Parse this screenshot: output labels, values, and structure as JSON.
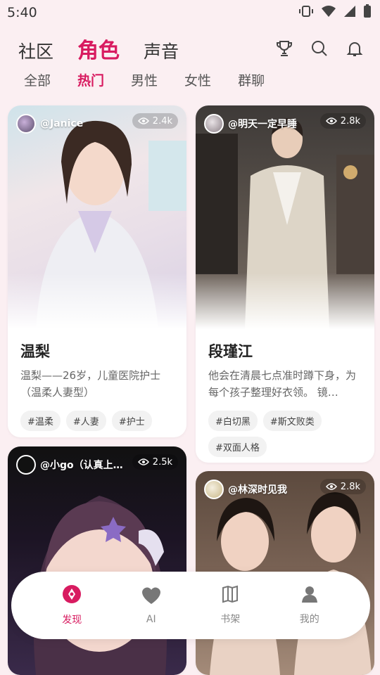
{
  "status_bar": {
    "time": "5:40"
  },
  "top_tabs": [
    {
      "label": "社区",
      "active": false
    },
    {
      "label": "角色",
      "active": true
    },
    {
      "label": "声音",
      "active": false
    }
  ],
  "sub_tabs": [
    {
      "label": "全部",
      "active": false
    },
    {
      "label": "热门",
      "active": true
    },
    {
      "label": "男性",
      "active": false
    },
    {
      "label": "女性",
      "active": false
    },
    {
      "label": "群聊",
      "active": false
    }
  ],
  "cards": [
    {
      "author": "@Janice",
      "views": "2.4k",
      "title": "温梨",
      "description": "温梨——26岁，儿童医院护士（温柔人妻型）",
      "tags": [
        "#温柔",
        "#人妻",
        "#护士"
      ]
    },
    {
      "author": "@明天一定早睡",
      "views": "2.8k",
      "title": "段瑾江",
      "description": "他会在清晨七点准时蹲下身，为每个孩子整理好衣领。 镜…",
      "tags": [
        "#白切黑",
        "#斯文败类",
        "#双面人格"
      ]
    },
    {
      "author": "@小go（认真上…",
      "views": "2.5k"
    },
    {
      "author": "@林深时见我",
      "views": "2.8k"
    }
  ],
  "bottom_nav": [
    {
      "label": "发现",
      "icon": "discover-icon",
      "active": true
    },
    {
      "label": "AI",
      "icon": "heart-icon",
      "active": false
    },
    {
      "label": "书架",
      "icon": "book-icon",
      "active": false
    },
    {
      "label": "我的",
      "icon": "profile-icon",
      "active": false
    }
  ],
  "colors": {
    "accent": "#d81b60",
    "background": "#fbeff2"
  }
}
